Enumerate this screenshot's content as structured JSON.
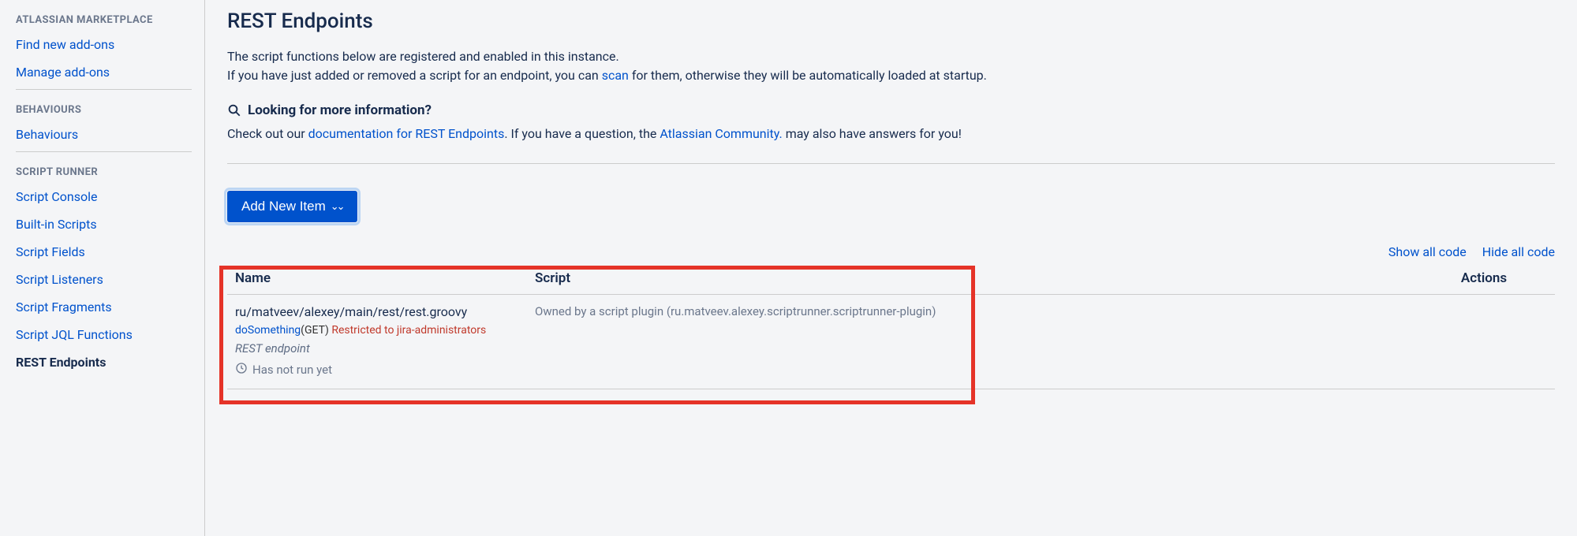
{
  "sidebar": {
    "sections": [
      {
        "heading": "ATLASSIAN MARKETPLACE",
        "items": [
          "Find new add-ons",
          "Manage add-ons"
        ]
      },
      {
        "heading": "BEHAVIOURS",
        "items": [
          "Behaviours"
        ]
      },
      {
        "heading": "SCRIPT RUNNER",
        "items": [
          "Script Console",
          "Built-in Scripts",
          "Script Fields",
          "Script Listeners",
          "Script Fragments",
          "Script JQL Functions",
          "REST Endpoints"
        ]
      }
    ],
    "active": "REST Endpoints"
  },
  "page": {
    "title": "REST Endpoints",
    "intro_line1": "The script functions below are registered and enabled in this instance.",
    "intro_line2_before": "If you have just added or removed a script for an endpoint, you can ",
    "intro_scan": "scan",
    "intro_line2_after": " for them, otherwise they will be automatically loaded at startup.",
    "info_heading": "Looking for more information?",
    "info_before": "Check out our ",
    "info_link1": "documentation for REST Endpoints",
    "info_mid": ". If you have a question, the ",
    "info_link2": "Atlassian Community.",
    "info_after": " may also have answers for you!",
    "add_button": "Add New Item",
    "show_all": "Show all code",
    "hide_all": "Hide all code"
  },
  "table": {
    "cols": {
      "name": "Name",
      "script": "Script",
      "actions": "Actions"
    },
    "rows": [
      {
        "path": "ru/matveev/alexey/main/rest/rest.groovy",
        "fn": "doSomething",
        "method": "(GET)",
        "restricted": "Restricted to jira-administrators",
        "type": "REST endpoint",
        "status": "Has not run yet",
        "script": "Owned by a script plugin (ru.matveev.alexey.scriptrunner.scriptrunner-plugin)"
      }
    ]
  }
}
